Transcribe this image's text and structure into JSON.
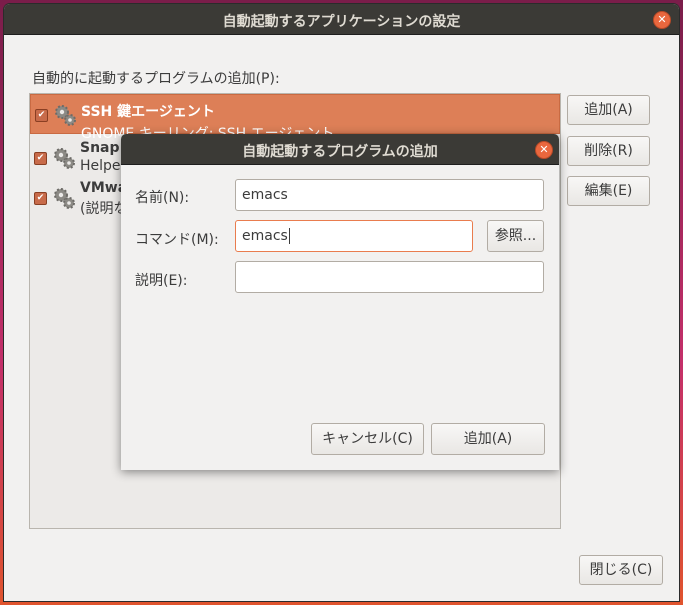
{
  "window": {
    "title": "自動起動するアプリケーションの設定",
    "close_glyph": "✕"
  },
  "main": {
    "list_label": "自動的に起動するプログラムの追加(P):",
    "items": [
      {
        "name": "SSH 鍵エージェント",
        "desc": "GNOME キーリング: SSH エージェント",
        "checked": true,
        "selected": true,
        "icon": "gear-icon"
      },
      {
        "name": "Snap u",
        "desc": "Helper",
        "checked": true,
        "selected": false,
        "icon": "gear-icon"
      },
      {
        "name": "VMwa",
        "desc": "(説明な",
        "checked": true,
        "selected": false,
        "icon": "gear-icon"
      }
    ],
    "buttons": {
      "add": "追加(A)",
      "remove": "削除(R)",
      "edit": "編集(E)",
      "close": "閉じる(C)"
    }
  },
  "dialog": {
    "title": "自動起動するプログラムの追加",
    "close_glyph": "✕",
    "name_label": "名前(N):",
    "name_value": "emacs",
    "command_label": "コマンド(M):",
    "command_value": "emacs",
    "browse_label": "参照...",
    "desc_label": "説明(E):",
    "desc_value": "",
    "cancel_label": "キャンセル(C)",
    "add_label": "追加(A)"
  },
  "colors": {
    "accent": "#e97c4e",
    "selection": "#dd7f57",
    "titlebar": "#3b3a36"
  }
}
